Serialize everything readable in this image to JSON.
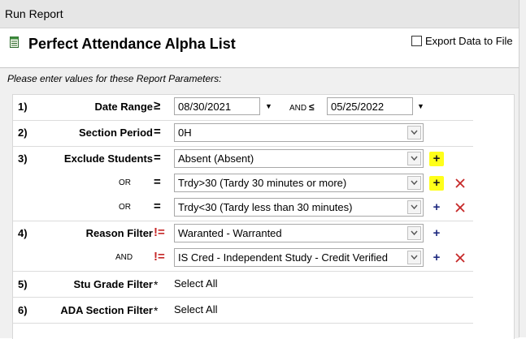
{
  "window": {
    "title": "Run Report"
  },
  "header": {
    "report_title": "Perfect Attendance Alpha List",
    "export_label": "Export Data to File",
    "export_checked": false,
    "icon": "report-sheet-icon"
  },
  "instructions": "Please enter values for these Report Parameters:",
  "params": {
    "date_range": {
      "number": "1)",
      "label": "Date Range",
      "operator": "≥",
      "start": "08/30/2021",
      "and_label": "AND",
      "end_operator": "≤",
      "end": "05/25/2022"
    },
    "section_period": {
      "number": "2)",
      "label": "Section Period",
      "operator": "=",
      "value": "0H"
    },
    "exclude_students": {
      "number": "3)",
      "label": "Exclude Students",
      "operator": "=",
      "values": [
        {
          "prefix": "",
          "operator": "=",
          "value": "Absent (Absent)"
        },
        {
          "prefix": "OR",
          "operator": "=",
          "value": "Trdy>30 (Tardy 30 minutes or more)"
        },
        {
          "prefix": "OR",
          "operator": "=",
          "value": "Trdy<30 (Tardy less than 30 minutes)"
        }
      ]
    },
    "reason_filter": {
      "number": "4)",
      "label": "Reason Filter",
      "operator": "!=",
      "values": [
        {
          "prefix": "",
          "operator": "!=",
          "value": "Waranted - Warranted"
        },
        {
          "prefix": "AND",
          "operator": "!=",
          "value": "IS Cred - Independent Study - Credit Verified"
        }
      ]
    },
    "stu_grade_filter": {
      "number": "5)",
      "label": "Stu Grade Filter",
      "operator": "*",
      "value": "Select All"
    },
    "ada_section_filter": {
      "number": "6)",
      "label": "ADA Section Filter",
      "operator": "*",
      "value": "Select All"
    }
  },
  "colors": {
    "highlight": "#ffff1a",
    "plus": "#1f2a80",
    "remove": "#c62828",
    "operator_not_equal": "#c62828"
  }
}
